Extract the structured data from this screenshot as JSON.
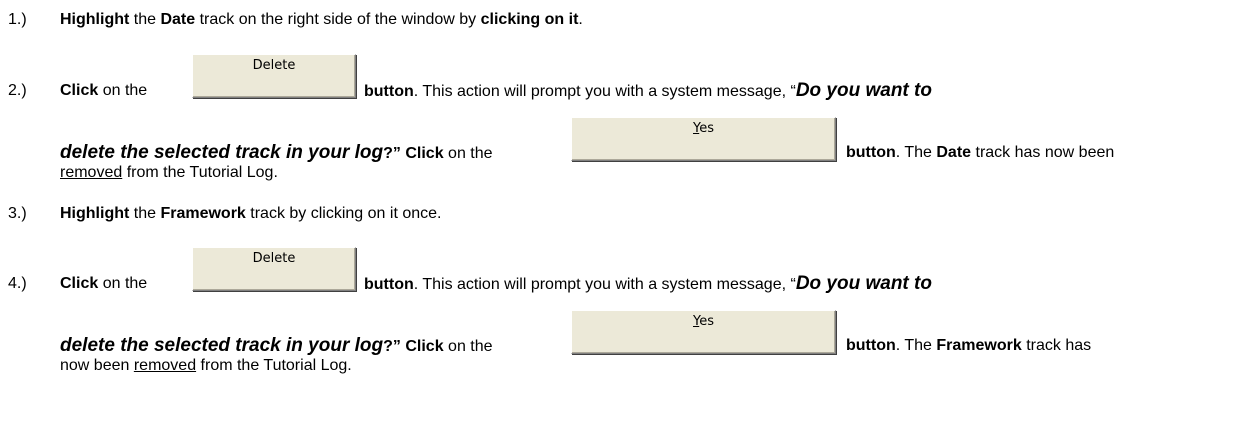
{
  "steps": [
    {
      "num": "1.)",
      "parts": {
        "a": "Highlight",
        "b": " the ",
        "c": "Date",
        "d": " track on the right side of the window by ",
        "e": "clicking on it",
        "f": "."
      }
    },
    {
      "num": "2.)",
      "parts": {
        "click": "Click",
        "on_the": " on the ",
        "button_word": "button",
        "prompt": ". This action will prompt you with a system message, “",
        "msg1": "Do you want to",
        "msg2": "delete the selected track in your log",
        "q_close": "?”",
        "click2": "Click",
        "on_the2": " on the ",
        "button_word2": "button",
        "the": ". The ",
        "track_name": "Date",
        "track_has": " track has now been",
        "removed": "removed",
        "from": " from the Tutorial Log."
      },
      "delete_label": "Delete",
      "yes_label_accel": "Y",
      "yes_label_rest": "es"
    },
    {
      "num": "3.)",
      "parts": {
        "a": "Highlight",
        "b": " the ",
        "c": "Framework",
        "d": " track by clicking on it once."
      }
    },
    {
      "num": "4.)",
      "parts": {
        "click": "Click",
        "on_the": " on the ",
        "button_word": "button",
        "prompt": ". This action will prompt you with a system message, “",
        "msg1": "Do you want to",
        "msg2": "delete the selected track in your log",
        "q_close": "?”",
        "click2": "Click",
        "on_the2": " on the ",
        "button_word2": "button",
        "the": ". The ",
        "track_name": "Framework",
        "track_has": " track has",
        "now_been": "now been ",
        "removed": "removed",
        "from": " from the Tutorial Log."
      },
      "delete_label": "Delete",
      "yes_label_accel": "Y",
      "yes_label_rest": "es"
    }
  ]
}
